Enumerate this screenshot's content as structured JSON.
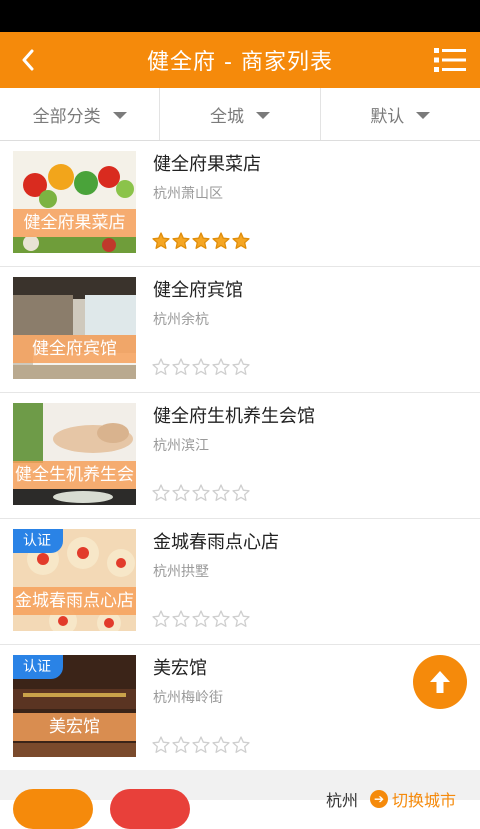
{
  "header": {
    "title": "健全府 - 商家列表",
    "back_icon": "back-chevron-icon",
    "menu_icon": "list-menu-icon"
  },
  "filters": [
    {
      "label": "全部分类"
    },
    {
      "label": "全城"
    },
    {
      "label": "默认"
    }
  ],
  "merchants": [
    {
      "name": "健全府果菜店",
      "location": "杭州萧山区",
      "thumb_text": "健全府果菜店",
      "badge": "",
      "rating": 5
    },
    {
      "name": "健全府宾馆",
      "location": "杭州余杭",
      "thumb_text": "健全府宾馆",
      "badge": "",
      "rating": 0
    },
    {
      "name": "健全府生机养生会馆",
      "location": "杭州滨江",
      "thumb_text": "健全生机养生会",
      "badge": "",
      "rating": 0
    },
    {
      "name": "金城春雨点心店",
      "location": "杭州拱墅",
      "thumb_text": "金城春雨点心店",
      "badge": "认证",
      "rating": 0
    },
    {
      "name": "美宏馆",
      "location": "杭州梅岭街",
      "thumb_text": "美宏馆",
      "badge": "认证",
      "rating": 0
    }
  ],
  "bottom": {
    "city": "杭州",
    "switch_label": "切换城市"
  },
  "colors": {
    "accent": "#f58a0b",
    "badge": "#2a83e6",
    "star_filled": "#f5a623",
    "star_empty": "#cfcfcf"
  }
}
